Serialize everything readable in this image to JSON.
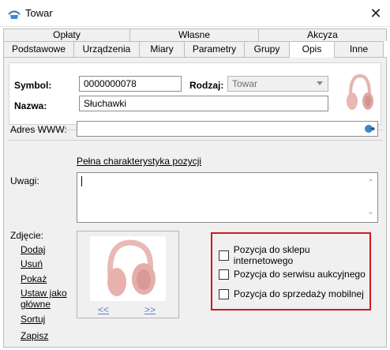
{
  "window": {
    "title": "Towar",
    "close_glyph": "✕"
  },
  "tabs": {
    "row1": [
      "Opłaty",
      "Własne",
      "Akcyza"
    ],
    "row2": [
      "Podstawowe",
      "Urządzenia",
      "Miary",
      "Parametry",
      "Grupy",
      "Opis",
      "Inne"
    ],
    "active": "Opis"
  },
  "header": {
    "symbol_label": "Symbol:",
    "symbol_value": "0000000078",
    "rodzaj_label": "Rodzaj:",
    "rodzaj_value": "Towar",
    "nazwa_label": "Nazwa:",
    "nazwa_value": "Słuchawki"
  },
  "form": {
    "www_label": "Adres WWW:",
    "www_value": "",
    "full_desc_link": "Pełna charakterystyka pozycji",
    "uwagi_label": "Uwagi:",
    "uwagi_value": ""
  },
  "photo": {
    "label": "Zdjęcie:",
    "actions": [
      "Dodaj",
      "Usuń",
      "Pokaż",
      "Ustaw jako",
      "główne",
      "Sortuj",
      "Zapisz"
    ],
    "prev": "<<",
    "next": ">>"
  },
  "options": {
    "items": [
      {
        "label": "Pozycja do sklepu internetowego",
        "checked": false
      },
      {
        "label": "Pozycja do serwisu aukcyjnego",
        "checked": false
      },
      {
        "label": "Pozycja do sprzedaży mobilnej",
        "checked": false
      }
    ],
    "highlight_color": "#d11a1a"
  },
  "colors": {
    "panel_bg": "#f0f0f0",
    "product_pink": "#e9b7b4"
  }
}
